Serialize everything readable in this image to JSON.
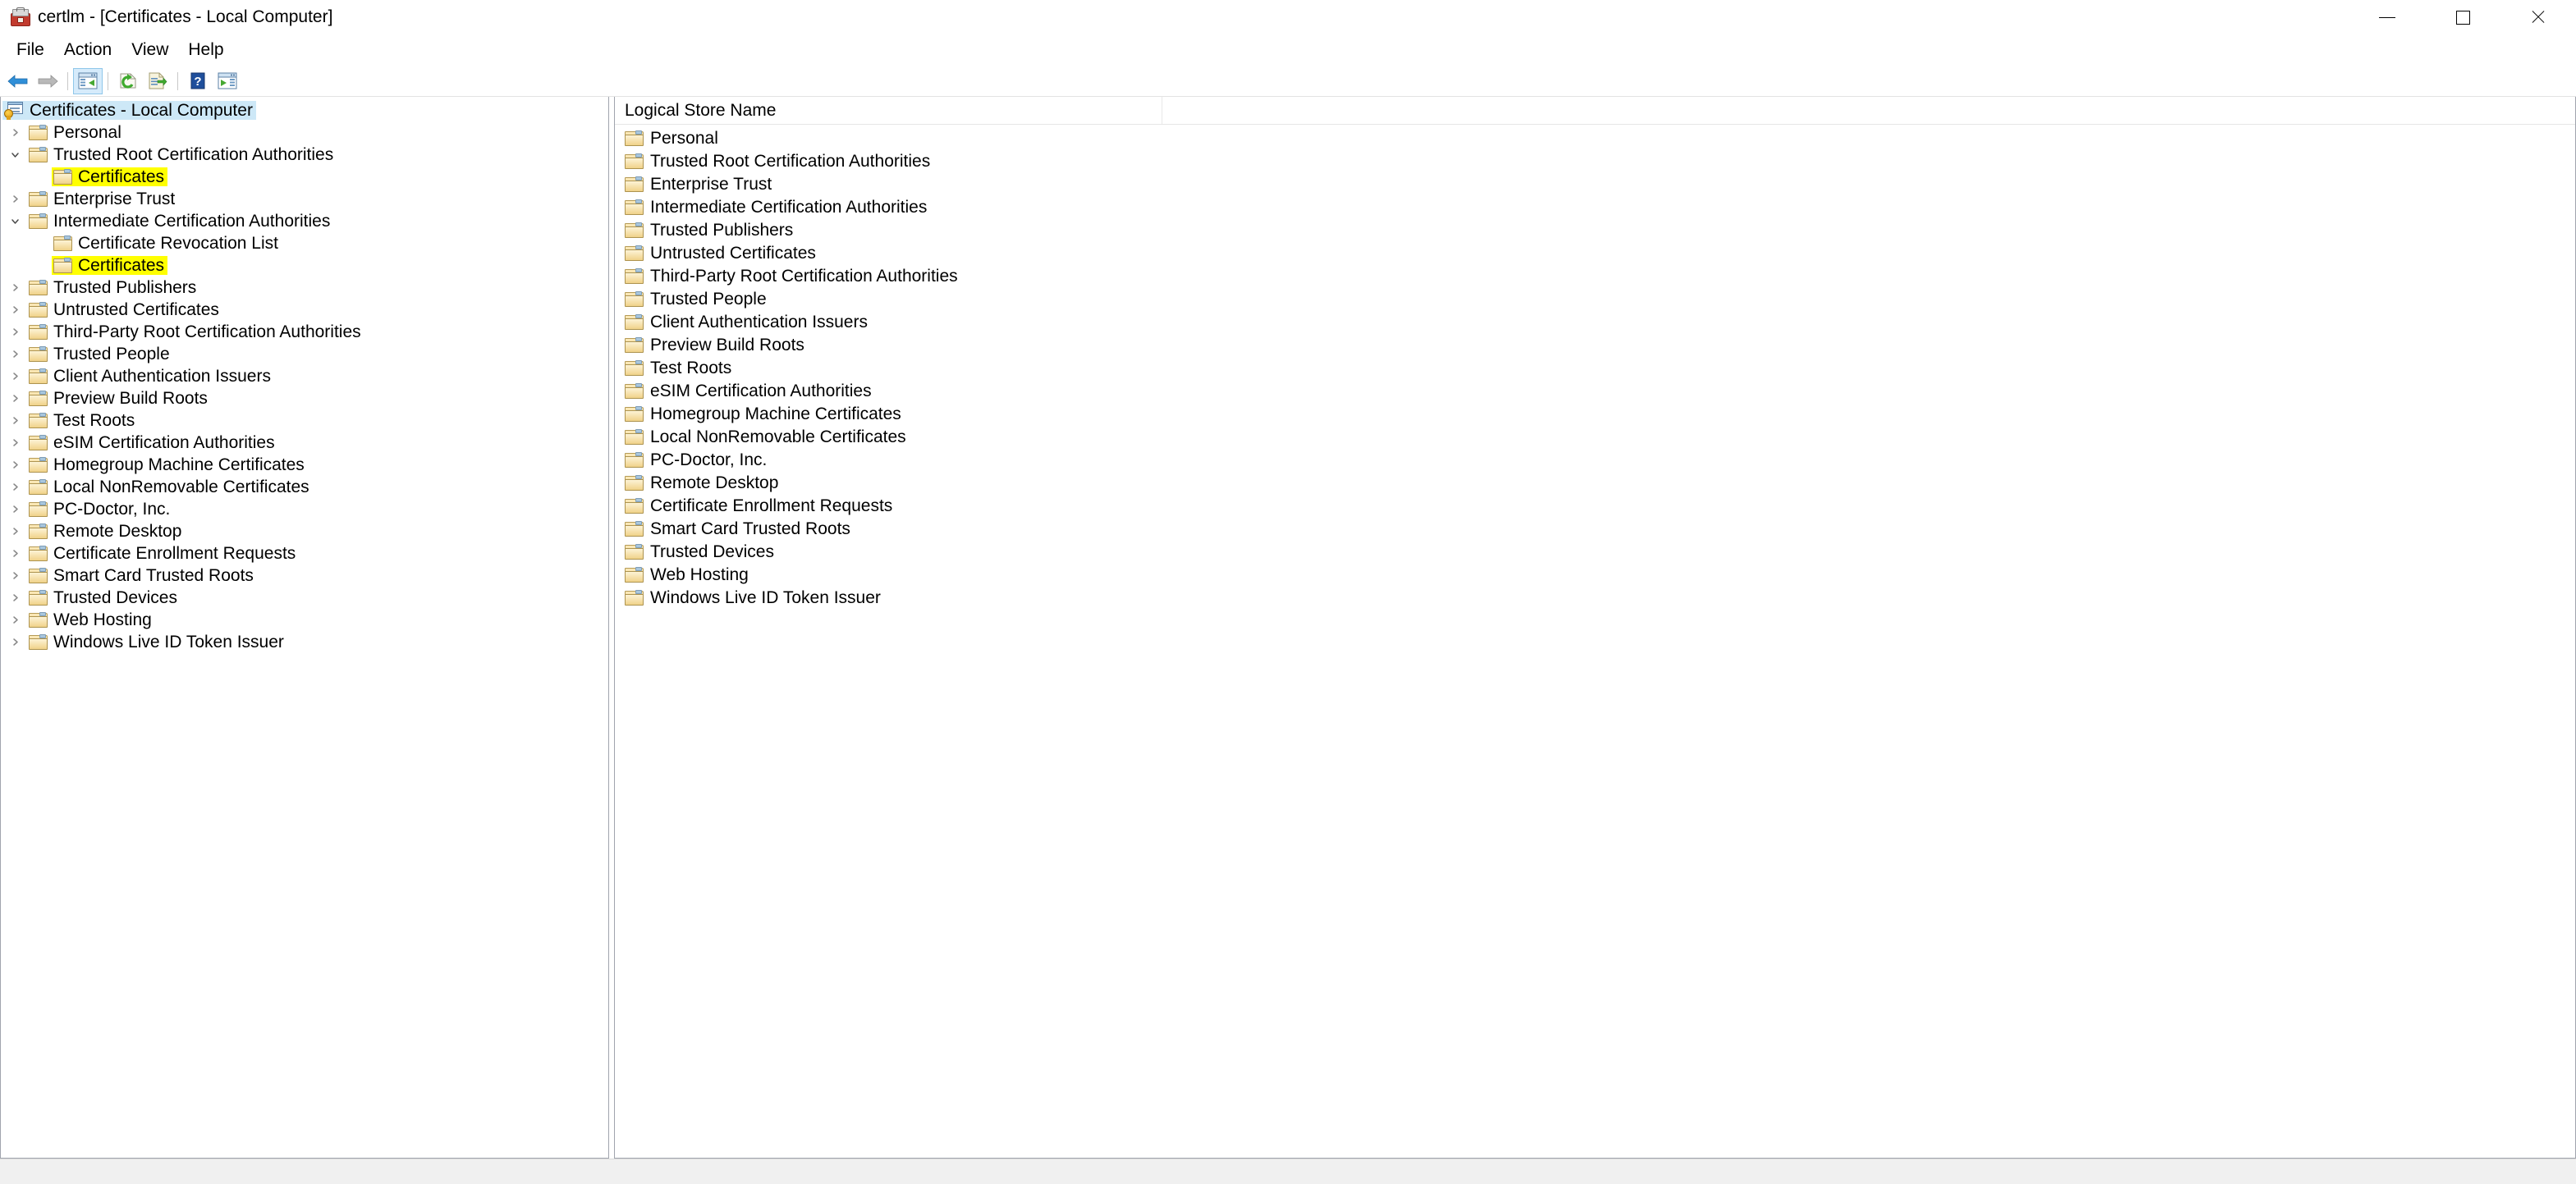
{
  "window": {
    "title": "certlm - [Certificates - Local Computer]",
    "app_icon": "certificate-toolbox-icon",
    "controls": {
      "minimize": "minimize-button",
      "maximize": "maximize-button",
      "close": "close-button"
    }
  },
  "menubar": {
    "items": [
      {
        "label": "File"
      },
      {
        "label": "Action"
      },
      {
        "label": "View"
      },
      {
        "label": "Help"
      }
    ]
  },
  "toolbar": {
    "buttons": [
      {
        "name": "back-button",
        "icon": "back-arrow-icon",
        "active": false
      },
      {
        "name": "forward-button",
        "icon": "forward-arrow-icon",
        "active": false
      },
      {
        "name": "show-hide-console-tree-button",
        "icon": "console-tree-icon",
        "active": true
      },
      {
        "name": "refresh-button",
        "icon": "refresh-icon",
        "active": false
      },
      {
        "name": "export-list-button",
        "icon": "export-list-icon",
        "active": false
      },
      {
        "name": "help-button",
        "icon": "question-mark-icon",
        "active": false
      },
      {
        "name": "show-hide-action-pane-button",
        "icon": "action-pane-icon",
        "active": false
      }
    ]
  },
  "tree": {
    "root": {
      "label": "Certificates - Local Computer",
      "icon": "console-root-icon",
      "selected": true,
      "expanded": true
    },
    "nodes": [
      {
        "label": "Personal",
        "depth": 1,
        "twisty": "collapsed",
        "icon": "folder-icon",
        "highlighted": false
      },
      {
        "label": "Trusted Root Certification Authorities",
        "depth": 1,
        "twisty": "expanded",
        "icon": "folder-icon",
        "highlighted": false
      },
      {
        "label": "Certificates",
        "depth": 2,
        "twisty": "none",
        "icon": "folder-icon",
        "highlighted": true
      },
      {
        "label": "Enterprise Trust",
        "depth": 1,
        "twisty": "collapsed",
        "icon": "folder-icon",
        "highlighted": false
      },
      {
        "label": "Intermediate Certification Authorities",
        "depth": 1,
        "twisty": "expanded",
        "icon": "folder-icon",
        "highlighted": false
      },
      {
        "label": "Certificate Revocation List",
        "depth": 2,
        "twisty": "none",
        "icon": "folder-icon",
        "highlighted": false
      },
      {
        "label": "Certificates",
        "depth": 2,
        "twisty": "none",
        "icon": "folder-icon",
        "highlighted": true
      },
      {
        "label": "Trusted Publishers",
        "depth": 1,
        "twisty": "collapsed",
        "icon": "folder-icon",
        "highlighted": false
      },
      {
        "label": "Untrusted Certificates",
        "depth": 1,
        "twisty": "collapsed",
        "icon": "folder-icon",
        "highlighted": false
      },
      {
        "label": "Third-Party Root Certification Authorities",
        "depth": 1,
        "twisty": "collapsed",
        "icon": "folder-icon",
        "highlighted": false
      },
      {
        "label": "Trusted People",
        "depth": 1,
        "twisty": "collapsed",
        "icon": "folder-icon",
        "highlighted": false
      },
      {
        "label": "Client Authentication Issuers",
        "depth": 1,
        "twisty": "collapsed",
        "icon": "folder-icon",
        "highlighted": false
      },
      {
        "label": "Preview Build Roots",
        "depth": 1,
        "twisty": "collapsed",
        "icon": "folder-icon",
        "highlighted": false
      },
      {
        "label": "Test Roots",
        "depth": 1,
        "twisty": "collapsed",
        "icon": "folder-icon",
        "highlighted": false
      },
      {
        "label": "eSIM Certification Authorities",
        "depth": 1,
        "twisty": "collapsed",
        "icon": "folder-icon",
        "highlighted": false
      },
      {
        "label": "Homegroup Machine Certificates",
        "depth": 1,
        "twisty": "collapsed",
        "icon": "folder-icon",
        "highlighted": false
      },
      {
        "label": "Local NonRemovable Certificates",
        "depth": 1,
        "twisty": "collapsed",
        "icon": "folder-icon",
        "highlighted": false
      },
      {
        "label": "PC-Doctor, Inc.",
        "depth": 1,
        "twisty": "collapsed",
        "icon": "folder-icon",
        "highlighted": false
      },
      {
        "label": "Remote Desktop",
        "depth": 1,
        "twisty": "collapsed",
        "icon": "folder-icon",
        "highlighted": false
      },
      {
        "label": "Certificate Enrollment Requests",
        "depth": 1,
        "twisty": "collapsed",
        "icon": "folder-icon",
        "highlighted": false
      },
      {
        "label": "Smart Card Trusted Roots",
        "depth": 1,
        "twisty": "collapsed",
        "icon": "folder-icon",
        "highlighted": false
      },
      {
        "label": "Trusted Devices",
        "depth": 1,
        "twisty": "collapsed",
        "icon": "folder-icon",
        "highlighted": false
      },
      {
        "label": "Web Hosting",
        "depth": 1,
        "twisty": "collapsed",
        "icon": "folder-icon",
        "highlighted": false
      },
      {
        "label": "Windows Live ID Token Issuer",
        "depth": 1,
        "twisty": "collapsed",
        "icon": "folder-icon",
        "highlighted": false
      }
    ]
  },
  "list": {
    "columns": [
      {
        "label": "Logical Store Name"
      }
    ],
    "rows": [
      {
        "label": "Personal",
        "icon": "folder-icon"
      },
      {
        "label": "Trusted Root Certification Authorities",
        "icon": "folder-icon"
      },
      {
        "label": "Enterprise Trust",
        "icon": "folder-icon"
      },
      {
        "label": "Intermediate Certification Authorities",
        "icon": "folder-icon"
      },
      {
        "label": "Trusted Publishers",
        "icon": "folder-icon"
      },
      {
        "label": "Untrusted Certificates",
        "icon": "folder-icon"
      },
      {
        "label": "Third-Party Root Certification Authorities",
        "icon": "folder-icon"
      },
      {
        "label": "Trusted People",
        "icon": "folder-icon"
      },
      {
        "label": "Client Authentication Issuers",
        "icon": "folder-icon"
      },
      {
        "label": "Preview Build Roots",
        "icon": "folder-icon"
      },
      {
        "label": "Test Roots",
        "icon": "folder-icon"
      },
      {
        "label": "eSIM Certification Authorities",
        "icon": "folder-icon"
      },
      {
        "label": "Homegroup Machine Certificates",
        "icon": "folder-icon"
      },
      {
        "label": "Local NonRemovable Certificates",
        "icon": "folder-icon"
      },
      {
        "label": "PC-Doctor, Inc.",
        "icon": "folder-icon"
      },
      {
        "label": "Remote Desktop",
        "icon": "folder-icon"
      },
      {
        "label": "Certificate Enrollment Requests",
        "icon": "folder-icon"
      },
      {
        "label": "Smart Card Trusted Roots",
        "icon": "folder-icon"
      },
      {
        "label": "Trusted Devices",
        "icon": "folder-icon"
      },
      {
        "label": "Web Hosting",
        "icon": "folder-icon"
      },
      {
        "label": "Windows Live ID Token Issuer",
        "icon": "folder-icon"
      }
    ]
  },
  "statusbar": {
    "text": ""
  },
  "colors": {
    "selection": "#cde8f7",
    "highlight": "#ffff00",
    "accent_blue": "#1e78c8",
    "folder": "#f0d289",
    "pane_border": "#a0a4ad",
    "statusbar": "#f0f0f0"
  }
}
